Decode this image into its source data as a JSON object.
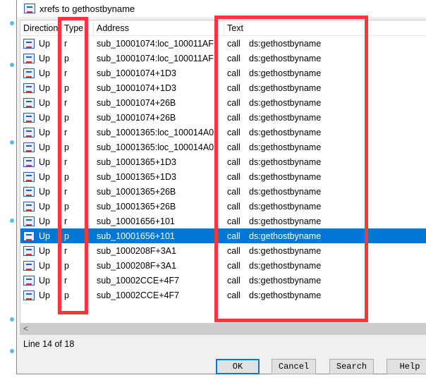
{
  "title": "xrefs to gethostbyname",
  "headers": [
    "Direction",
    "Type",
    "Address",
    "Text"
  ],
  "rows": [
    {
      "dir": "Up",
      "type": "r",
      "addr": "sub_10001074:loc_100011AF",
      "op": "call",
      "arg": "ds:gethostbyname"
    },
    {
      "dir": "Up",
      "type": "p",
      "addr": "sub_10001074:loc_100011AF",
      "op": "call",
      "arg": "ds:gethostbyname"
    },
    {
      "dir": "Up",
      "type": "r",
      "addr": "sub_10001074+1D3",
      "op": "call",
      "arg": "ds:gethostbyname"
    },
    {
      "dir": "Up",
      "type": "p",
      "addr": "sub_10001074+1D3",
      "op": "call",
      "arg": "ds:gethostbyname"
    },
    {
      "dir": "Up",
      "type": "r",
      "addr": "sub_10001074+26B",
      "op": "call",
      "arg": "ds:gethostbyname"
    },
    {
      "dir": "Up",
      "type": "p",
      "addr": "sub_10001074+26B",
      "op": "call",
      "arg": "ds:gethostbyname"
    },
    {
      "dir": "Up",
      "type": "r",
      "addr": "sub_10001365:loc_100014A0",
      "op": "call",
      "arg": "ds:gethostbyname"
    },
    {
      "dir": "Up",
      "type": "p",
      "addr": "sub_10001365:loc_100014A0",
      "op": "call",
      "arg": "ds:gethostbyname"
    },
    {
      "dir": "Up",
      "type": "r",
      "addr": "sub_10001365+1D3",
      "op": "call",
      "arg": "ds:gethostbyname"
    },
    {
      "dir": "Up",
      "type": "p",
      "addr": "sub_10001365+1D3",
      "op": "call",
      "arg": "ds:gethostbyname"
    },
    {
      "dir": "Up",
      "type": "r",
      "addr": "sub_10001365+26B",
      "op": "call",
      "arg": "ds:gethostbyname"
    },
    {
      "dir": "Up",
      "type": "p",
      "addr": "sub_10001365+26B",
      "op": "call",
      "arg": "ds:gethostbyname"
    },
    {
      "dir": "Up",
      "type": "r",
      "addr": "sub_10001656+101",
      "op": "call",
      "arg": "ds:gethostbyname"
    },
    {
      "dir": "Up",
      "type": "p",
      "addr": "sub_10001656+101",
      "op": "call",
      "arg": "ds:gethostbyname"
    },
    {
      "dir": "Up",
      "type": "r",
      "addr": "sub_1000208F+3A1",
      "op": "call",
      "arg": "ds:gethostbyname"
    },
    {
      "dir": "Up",
      "type": "p",
      "addr": "sub_1000208F+3A1",
      "op": "call",
      "arg": "ds:gethostbyname"
    },
    {
      "dir": "Up",
      "type": "r",
      "addr": "sub_10002CCE+4F7",
      "op": "call",
      "arg": "ds:gethostbyname"
    },
    {
      "dir": "Up",
      "type": "p",
      "addr": "sub_10002CCE+4F7",
      "op": "call",
      "arg": "ds:gethostbyname"
    }
  ],
  "selected_index": 13,
  "status": "Line 14 of 18",
  "scroll_left": "<",
  "buttons": {
    "ok": "OK",
    "cancel": "Cancel",
    "search": "Search",
    "help": "Help"
  }
}
